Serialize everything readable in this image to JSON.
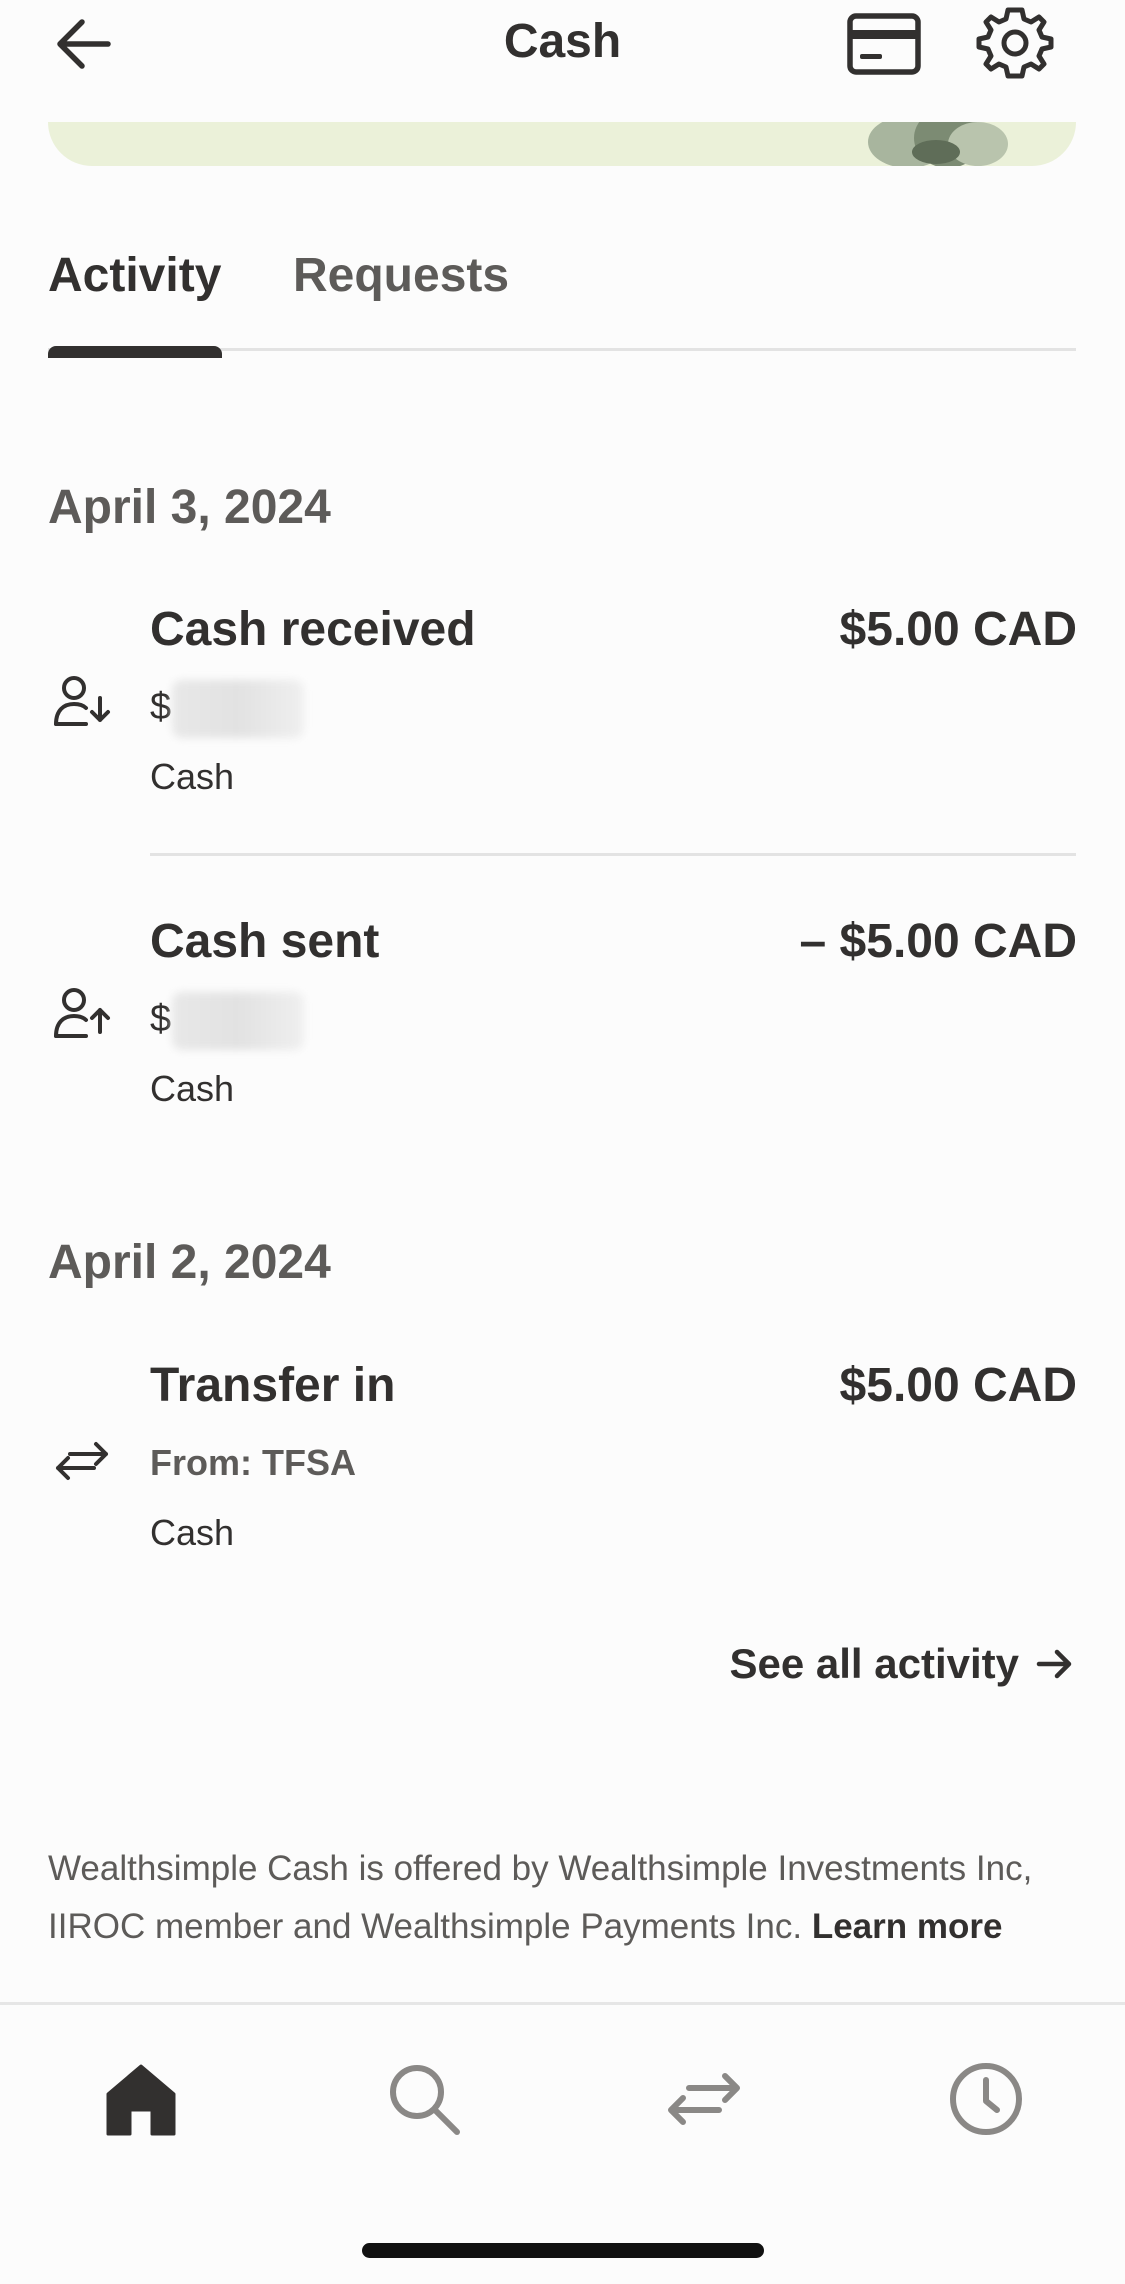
{
  "header": {
    "title": "Cash",
    "back_icon": "arrow-left-icon",
    "card_icon": "credit-card-icon",
    "settings_icon": "gear-icon"
  },
  "tabs": [
    {
      "label": "Activity",
      "active": true
    },
    {
      "label": "Requests",
      "active": false
    }
  ],
  "groups": [
    {
      "date": "April 3, 2024",
      "transactions": [
        {
          "icon": "person-receive-icon",
          "title": "Cash received",
          "amount": "$5.00 CAD",
          "sub": "$",
          "account": "Cash"
        },
        {
          "icon": "person-send-icon",
          "title": "Cash sent",
          "amount": "– $5.00 CAD",
          "sub": "$",
          "account": "Cash"
        }
      ]
    },
    {
      "date": "April 2, 2024",
      "transactions": [
        {
          "icon": "transfer-icon",
          "title": "Transfer in",
          "amount": "$5.00 CAD",
          "sub": "From: TFSA",
          "account": "Cash"
        }
      ]
    }
  ],
  "see_all": "See all activity",
  "disclaimer": {
    "text": "Wealthsimple Cash is offered by Wealthsimple Investments Inc, IIROC member and Wealthsimple Payments Inc.",
    "link": "Learn more"
  },
  "bottom_nav": [
    {
      "icon": "home-icon",
      "active": true
    },
    {
      "icon": "search-icon",
      "active": false
    },
    {
      "icon": "transfer-icon",
      "active": false
    },
    {
      "icon": "clock-icon",
      "active": false
    }
  ],
  "colors": {
    "text_primary": "#32302f",
    "text_secondary": "#5d5b59",
    "banner": "#ebf1d9",
    "inactive_icon": "#8a8886"
  }
}
